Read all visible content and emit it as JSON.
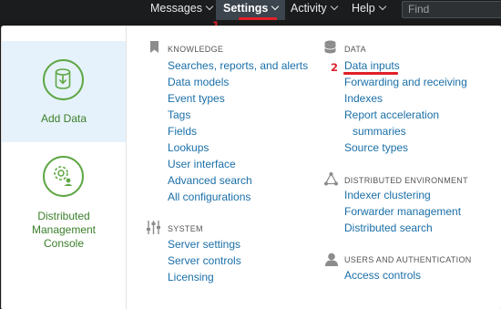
{
  "nav": {
    "messages": "Messages",
    "settings": "Settings",
    "activity": "Activity",
    "help": "Help",
    "find_placeholder": "Find"
  },
  "annotations": {
    "step1": "1",
    "step2": "2"
  },
  "tiles": {
    "add_data": "Add Data",
    "dmc_line1": "Distributed",
    "dmc_line2": "Management",
    "dmc_line3": "Console"
  },
  "knowledge": {
    "heading": "KNOWLEDGE",
    "items": [
      "Searches, reports, and alerts",
      "Data models",
      "Event types",
      "Tags",
      "Fields",
      "Lookups",
      "User interface",
      "Advanced search",
      "All configurations"
    ]
  },
  "system": {
    "heading": "SYSTEM",
    "items": [
      "Server settings",
      "Server controls",
      "Licensing"
    ]
  },
  "data": {
    "heading": "DATA",
    "items": [
      "Data inputs",
      "Forwarding and receiving",
      "Indexes",
      "Report acceleration",
      "summaries",
      "Source types"
    ]
  },
  "distributed": {
    "heading": "DISTRIBUTED ENVIRONMENT",
    "items": [
      "Indexer clustering",
      "Forwarder management",
      "Distributed search"
    ]
  },
  "users": {
    "heading": "USERS AND AUTHENTICATION",
    "items": [
      "Access controls"
    ]
  },
  "colors": {
    "accent_green": "#5fa745",
    "link_blue": "#1a6fa8",
    "annotation_red": "#e0202a",
    "tile_highlight": "#e6f2fb"
  }
}
